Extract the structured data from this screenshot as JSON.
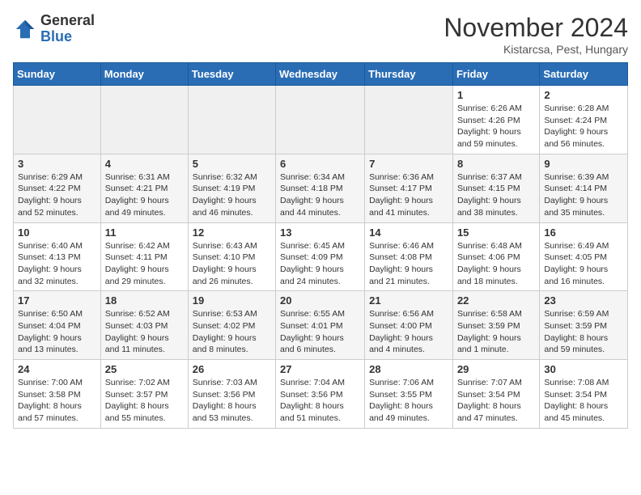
{
  "logo": {
    "general": "General",
    "blue": "Blue"
  },
  "title": "November 2024",
  "location": "Kistarcsa, Pest, Hungary",
  "days_of_week": [
    "Sunday",
    "Monday",
    "Tuesday",
    "Wednesday",
    "Thursday",
    "Friday",
    "Saturday"
  ],
  "weeks": [
    [
      {
        "day": "",
        "info": ""
      },
      {
        "day": "",
        "info": ""
      },
      {
        "day": "",
        "info": ""
      },
      {
        "day": "",
        "info": ""
      },
      {
        "day": "",
        "info": ""
      },
      {
        "day": "1",
        "info": "Sunrise: 6:26 AM\nSunset: 4:26 PM\nDaylight: 9 hours and 59 minutes."
      },
      {
        "day": "2",
        "info": "Sunrise: 6:28 AM\nSunset: 4:24 PM\nDaylight: 9 hours and 56 minutes."
      }
    ],
    [
      {
        "day": "3",
        "info": "Sunrise: 6:29 AM\nSunset: 4:22 PM\nDaylight: 9 hours and 52 minutes."
      },
      {
        "day": "4",
        "info": "Sunrise: 6:31 AM\nSunset: 4:21 PM\nDaylight: 9 hours and 49 minutes."
      },
      {
        "day": "5",
        "info": "Sunrise: 6:32 AM\nSunset: 4:19 PM\nDaylight: 9 hours and 46 minutes."
      },
      {
        "day": "6",
        "info": "Sunrise: 6:34 AM\nSunset: 4:18 PM\nDaylight: 9 hours and 44 minutes."
      },
      {
        "day": "7",
        "info": "Sunrise: 6:36 AM\nSunset: 4:17 PM\nDaylight: 9 hours and 41 minutes."
      },
      {
        "day": "8",
        "info": "Sunrise: 6:37 AM\nSunset: 4:15 PM\nDaylight: 9 hours and 38 minutes."
      },
      {
        "day": "9",
        "info": "Sunrise: 6:39 AM\nSunset: 4:14 PM\nDaylight: 9 hours and 35 minutes."
      }
    ],
    [
      {
        "day": "10",
        "info": "Sunrise: 6:40 AM\nSunset: 4:13 PM\nDaylight: 9 hours and 32 minutes."
      },
      {
        "day": "11",
        "info": "Sunrise: 6:42 AM\nSunset: 4:11 PM\nDaylight: 9 hours and 29 minutes."
      },
      {
        "day": "12",
        "info": "Sunrise: 6:43 AM\nSunset: 4:10 PM\nDaylight: 9 hours and 26 minutes."
      },
      {
        "day": "13",
        "info": "Sunrise: 6:45 AM\nSunset: 4:09 PM\nDaylight: 9 hours and 24 minutes."
      },
      {
        "day": "14",
        "info": "Sunrise: 6:46 AM\nSunset: 4:08 PM\nDaylight: 9 hours and 21 minutes."
      },
      {
        "day": "15",
        "info": "Sunrise: 6:48 AM\nSunset: 4:06 PM\nDaylight: 9 hours and 18 minutes."
      },
      {
        "day": "16",
        "info": "Sunrise: 6:49 AM\nSunset: 4:05 PM\nDaylight: 9 hours and 16 minutes."
      }
    ],
    [
      {
        "day": "17",
        "info": "Sunrise: 6:50 AM\nSunset: 4:04 PM\nDaylight: 9 hours and 13 minutes."
      },
      {
        "day": "18",
        "info": "Sunrise: 6:52 AM\nSunset: 4:03 PM\nDaylight: 9 hours and 11 minutes."
      },
      {
        "day": "19",
        "info": "Sunrise: 6:53 AM\nSunset: 4:02 PM\nDaylight: 9 hours and 8 minutes."
      },
      {
        "day": "20",
        "info": "Sunrise: 6:55 AM\nSunset: 4:01 PM\nDaylight: 9 hours and 6 minutes."
      },
      {
        "day": "21",
        "info": "Sunrise: 6:56 AM\nSunset: 4:00 PM\nDaylight: 9 hours and 4 minutes."
      },
      {
        "day": "22",
        "info": "Sunrise: 6:58 AM\nSunset: 3:59 PM\nDaylight: 9 hours and 1 minute."
      },
      {
        "day": "23",
        "info": "Sunrise: 6:59 AM\nSunset: 3:59 PM\nDaylight: 8 hours and 59 minutes."
      }
    ],
    [
      {
        "day": "24",
        "info": "Sunrise: 7:00 AM\nSunset: 3:58 PM\nDaylight: 8 hours and 57 minutes."
      },
      {
        "day": "25",
        "info": "Sunrise: 7:02 AM\nSunset: 3:57 PM\nDaylight: 8 hours and 55 minutes."
      },
      {
        "day": "26",
        "info": "Sunrise: 7:03 AM\nSunset: 3:56 PM\nDaylight: 8 hours and 53 minutes."
      },
      {
        "day": "27",
        "info": "Sunrise: 7:04 AM\nSunset: 3:56 PM\nDaylight: 8 hours and 51 minutes."
      },
      {
        "day": "28",
        "info": "Sunrise: 7:06 AM\nSunset: 3:55 PM\nDaylight: 8 hours and 49 minutes."
      },
      {
        "day": "29",
        "info": "Sunrise: 7:07 AM\nSunset: 3:54 PM\nDaylight: 8 hours and 47 minutes."
      },
      {
        "day": "30",
        "info": "Sunrise: 7:08 AM\nSunset: 3:54 PM\nDaylight: 8 hours and 45 minutes."
      }
    ]
  ]
}
